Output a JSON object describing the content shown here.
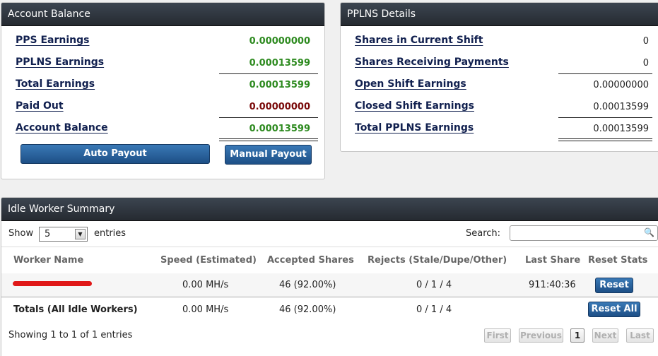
{
  "account_balance": {
    "title": "Account Balance",
    "rows": [
      {
        "label": "PPS Earnings",
        "value": "0.00000000"
      },
      {
        "label": "PPLNS Earnings",
        "value": "0.00013599"
      },
      {
        "label": "Total Earnings",
        "value": "0.00013599"
      },
      {
        "label": "Paid Out",
        "value": "0.00000000"
      },
      {
        "label": "Account Balance",
        "value": "0.00013599"
      }
    ],
    "auto_payout_label": "Auto Payout",
    "manual_payout_label": "Manual Payout"
  },
  "pplns_details": {
    "title": "PPLNS Details",
    "rows": [
      {
        "label": "Shares in Current Shift",
        "value": "0"
      },
      {
        "label": "Shares Receiving Payments",
        "value": "0"
      },
      {
        "label": "Open Shift Earnings",
        "value": "0.00000000"
      },
      {
        "label": "Closed Shift Earnings",
        "value": "0.00013599"
      },
      {
        "label": "Total PPLNS Earnings",
        "value": "0.00013599"
      }
    ]
  },
  "idle_workers": {
    "title": "Idle Worker Summary",
    "show_label": "Show",
    "show_value": "5",
    "entries_label": "entries",
    "search_label": "Search:",
    "search_value": "",
    "columns": [
      "Worker Name",
      "Speed (Estimated)",
      "Accepted Shares",
      "Rejects (Stale/Dupe/Other)",
      "Last Share",
      "Reset Stats"
    ],
    "rows": [
      {
        "worker": "",
        "speed": "0.00 MH/s",
        "accepted": "46 (92.00%)",
        "rejects": "0 / 1 / 4",
        "last_share": "911:40:36",
        "reset_label": "Reset"
      }
    ],
    "totals": {
      "label": "Totals (All Idle Workers)",
      "speed": "0.00 MH/s",
      "accepted": "46 (92.00%)",
      "rejects": "0 / 1 / 4",
      "reset_all_label": "Reset All"
    },
    "info": "Showing 1 to 1 of 1 entries",
    "pagination": {
      "first": "First",
      "previous": "Previous",
      "current": "1",
      "next": "Next",
      "last": "Last"
    }
  },
  "colors": {
    "positive": "#2d8a1f",
    "negative": "#7a0a0a",
    "header": "#2b3138",
    "button": "#1d4f86"
  }
}
